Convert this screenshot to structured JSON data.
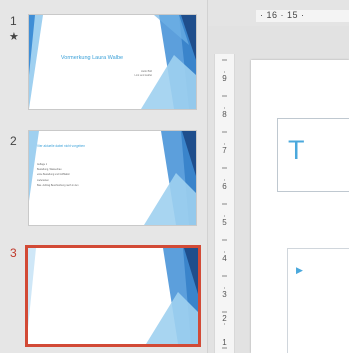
{
  "thumbnails": {
    "slides": [
      {
        "number": "1",
        "star": "★",
        "title": "Vormerkung Laura Walbe",
        "subtitle_line1": "Hello Bild",
        "subtitle_line2": "Link and leaflet"
      },
      {
        "number": "2",
        "title": "Vier aktuelle dabei nicht vorgeben",
        "lines": [
          "Auflage 1",
          "Bestellung, Wasserbau",
          "erste Bestellung und Grifffaktor",
          "Lieferanten",
          "Bau. Auftrag Beschreibung nach in den"
        ]
      },
      {
        "number": "3"
      }
    ],
    "accent_colors": {
      "selection": "#d24a36",
      "theme_dark": "#1f4e8c",
      "theme_mid": "#3f8ed6",
      "theme_light": "#9fd0f0"
    }
  },
  "editor": {
    "ruler_h_text": "· 16 · 15 ·",
    "ruler_v_numbers": [
      "9",
      "8",
      "7",
      "6",
      "5",
      "4",
      "3",
      "2",
      "1"
    ],
    "title_placeholder_text": "T",
    "content_marker": "▶"
  }
}
